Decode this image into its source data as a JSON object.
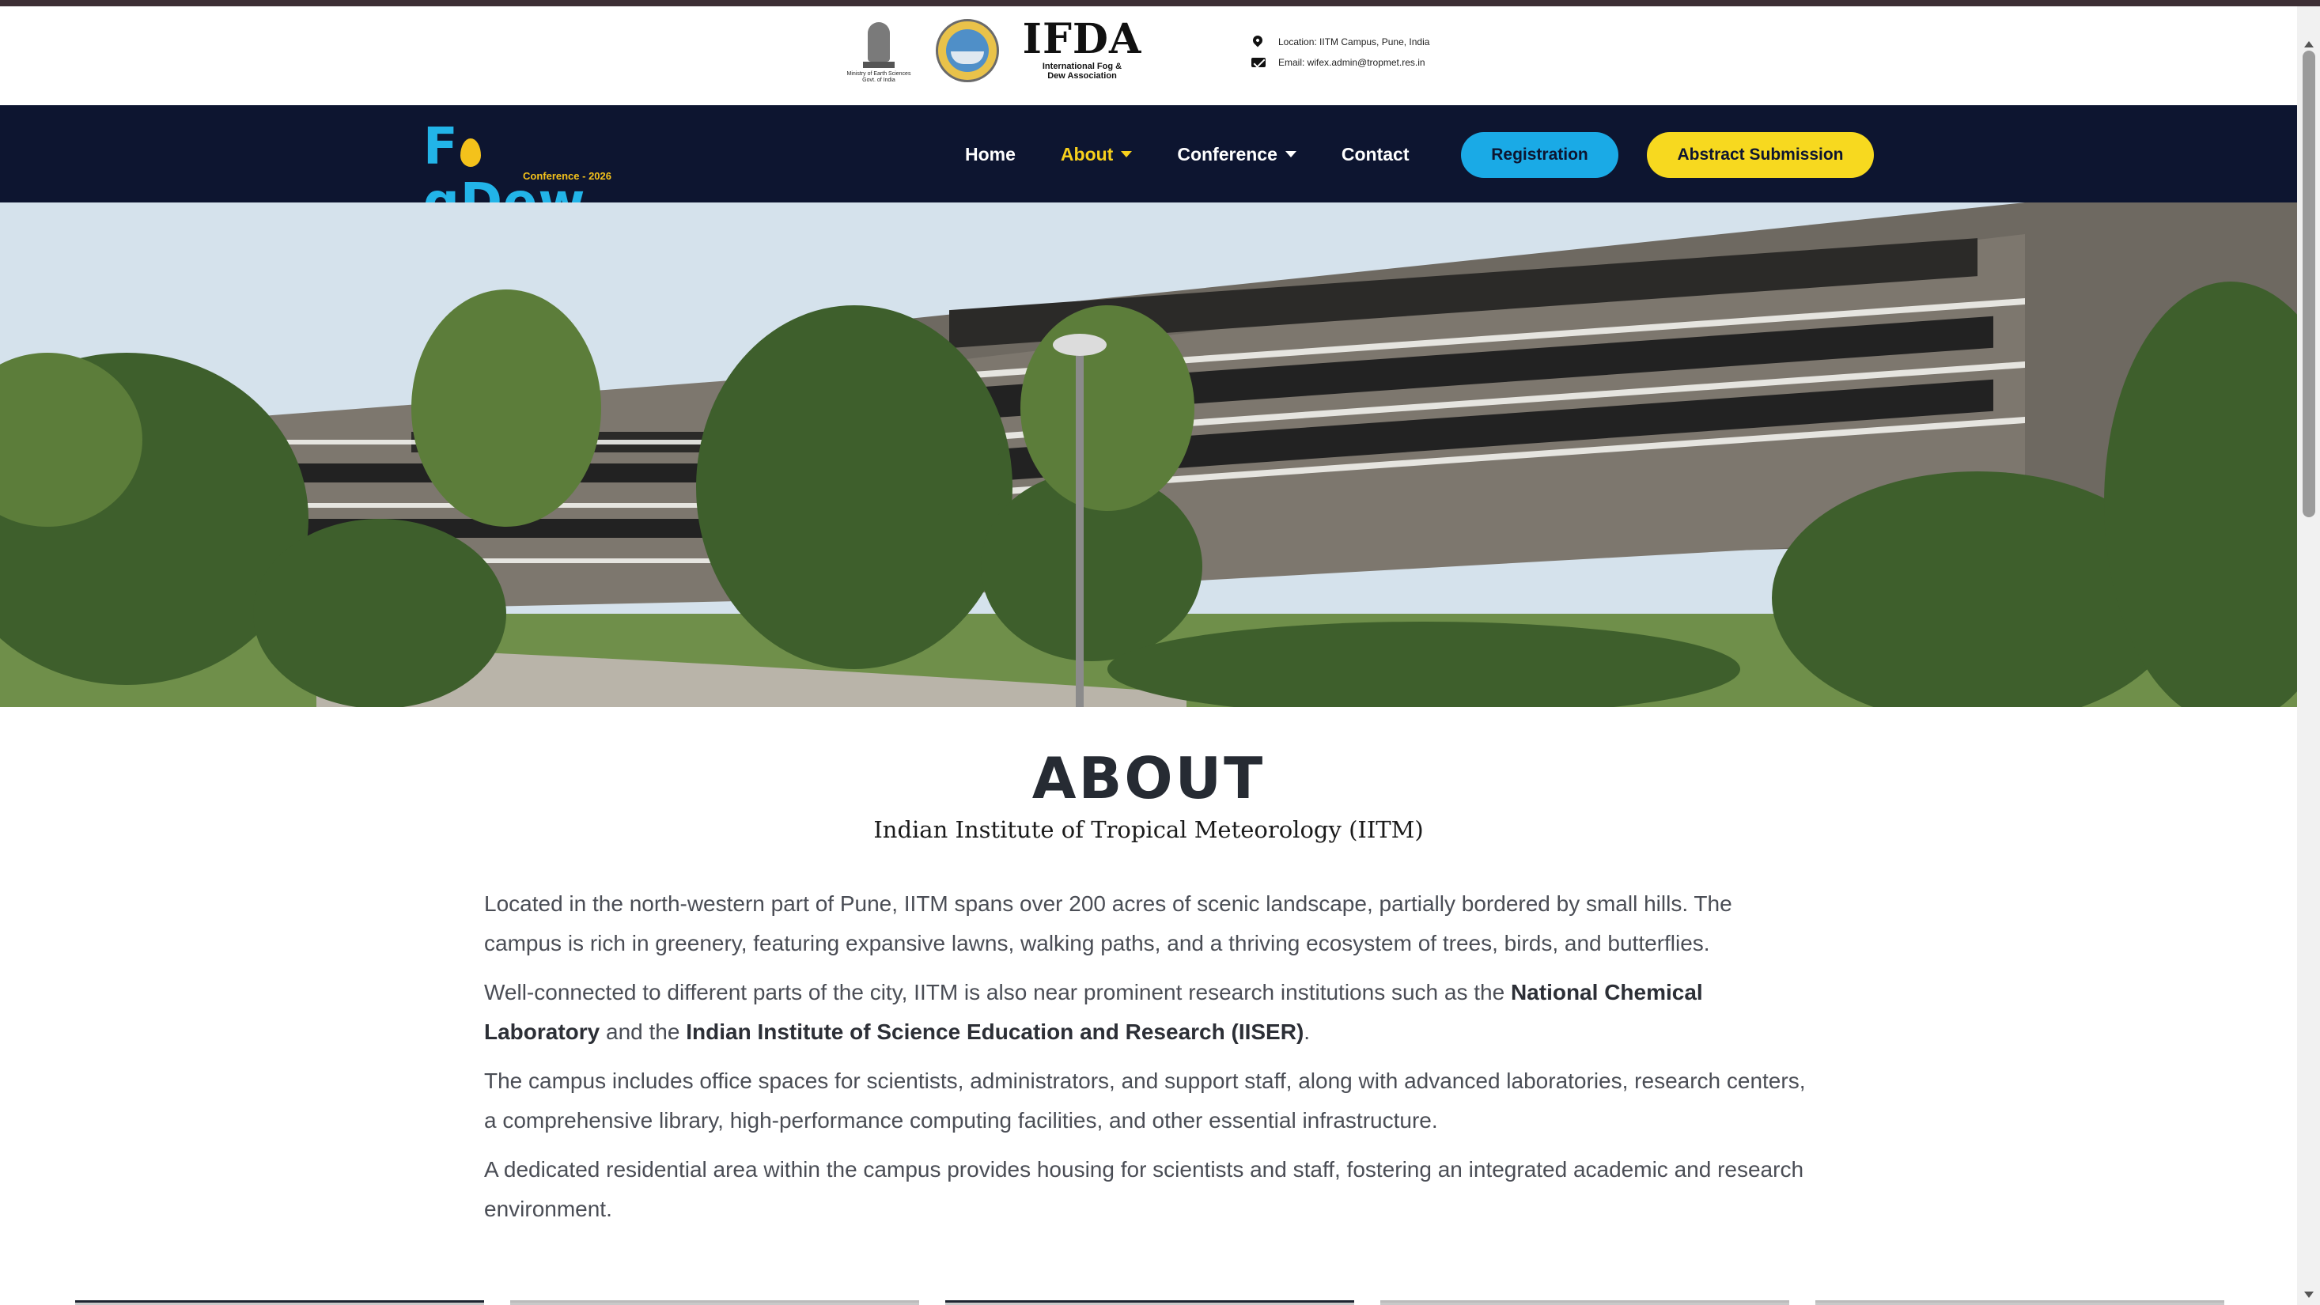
{
  "header": {
    "emblem_caption": "Ministry of Earth Sciences Govt. of India",
    "ifda_title": "IFDA",
    "ifda_subtitle": "International Fog & Dew Association",
    "location": "Location: IITM Campus, Pune, India",
    "email": "Email: wifex.admin@tropmet.res.in"
  },
  "brand": {
    "logo_f": "F",
    "logo_rest": "gDew",
    "subtitle": "Conference - 2026"
  },
  "nav": {
    "items": [
      {
        "label": "Home"
      },
      {
        "label": "About"
      },
      {
        "label": "Conference"
      },
      {
        "label": "Contact"
      }
    ],
    "registration_label": "Registration",
    "abstract_label": "Abstract Submission"
  },
  "colors": {
    "navbar_bg": "#0d1530",
    "accent_blue": "#1aaae6",
    "accent_yellow": "#f7d91f",
    "active_link": "#f7d01c"
  },
  "about": {
    "title": "ABOUT",
    "subtitle": "Indian Institute of Tropical Meteorology (IITM)",
    "p1": "Located in the north-western part of Pune, IITM spans over 200 acres of scenic landscape, partially bordered by small hills. The campus is rich in greenery, featuring expansive lawns, walking paths, and a thriving ecosystem of trees, birds, and butterflies.",
    "p2_a": "Well-connected to different parts of the city, IITM is also near prominent research institutions such as the ",
    "p2_b1": "National Chemical Laboratory",
    "p2_c": " and the ",
    "p2_b2": "Indian Institute of Science Education and Research (IISER)",
    "p2_d": ".",
    "p3": "The campus includes office spaces for scientists, administrators, and support staff, along with advanced laboratories, research centers, a comprehensive library, high-performance computing facilities, and other essential infrastructure.",
    "p4": "A dedicated residential area within the campus provides housing for scientists and staff, fostering an integrated academic and research environment."
  }
}
